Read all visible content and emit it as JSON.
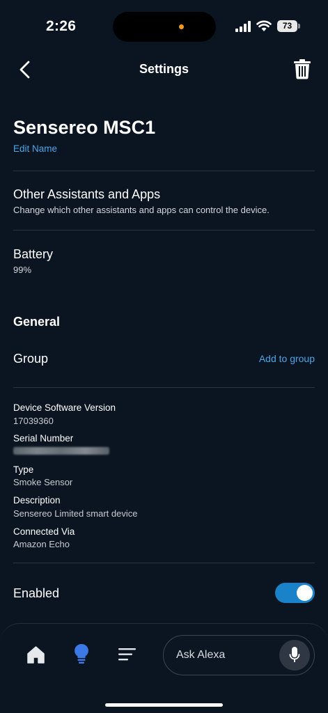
{
  "status_bar": {
    "time": "2:26",
    "battery_level": "73",
    "icons": [
      "cellular-signal-icon",
      "wifi-icon",
      "battery-icon"
    ],
    "indicator_color": "#f59a1c"
  },
  "header": {
    "title": "Settings",
    "back_icon": "chevron-left-icon",
    "delete_icon": "trash-icon"
  },
  "device": {
    "name": "Sensereo MSC1",
    "edit_label": "Edit Name"
  },
  "other_assistants": {
    "title": "Other Assistants and Apps",
    "subtitle": "Change which other assistants and apps can control the device."
  },
  "battery": {
    "title": "Battery",
    "value": "99%"
  },
  "general": {
    "heading": "General",
    "group_label": "Group",
    "add_group_label": "Add to group"
  },
  "info": [
    {
      "label": "Device Software Version",
      "value": "17039360"
    },
    {
      "label": "Serial Number",
      "value": ""
    },
    {
      "label": "Type",
      "value": "Smoke Sensor"
    },
    {
      "label": "Description",
      "value": "Sensereo Limited smart device"
    },
    {
      "label": "Connected Via",
      "value": "Amazon Echo"
    }
  ],
  "enabled": {
    "label": "Enabled",
    "on": true
  },
  "bottom_nav": {
    "items": [
      "home-icon",
      "devices-bulb-icon",
      "more-menu-icon"
    ],
    "active": "devices-bulb-icon",
    "ask_placeholder": "Ask Alexa",
    "mic_icon": "microphone-icon"
  },
  "colors": {
    "background": "#0b1521",
    "accent": "#4aa6e8",
    "toggle_on": "#1a82c9",
    "active_nav": "#3b7ae6"
  }
}
